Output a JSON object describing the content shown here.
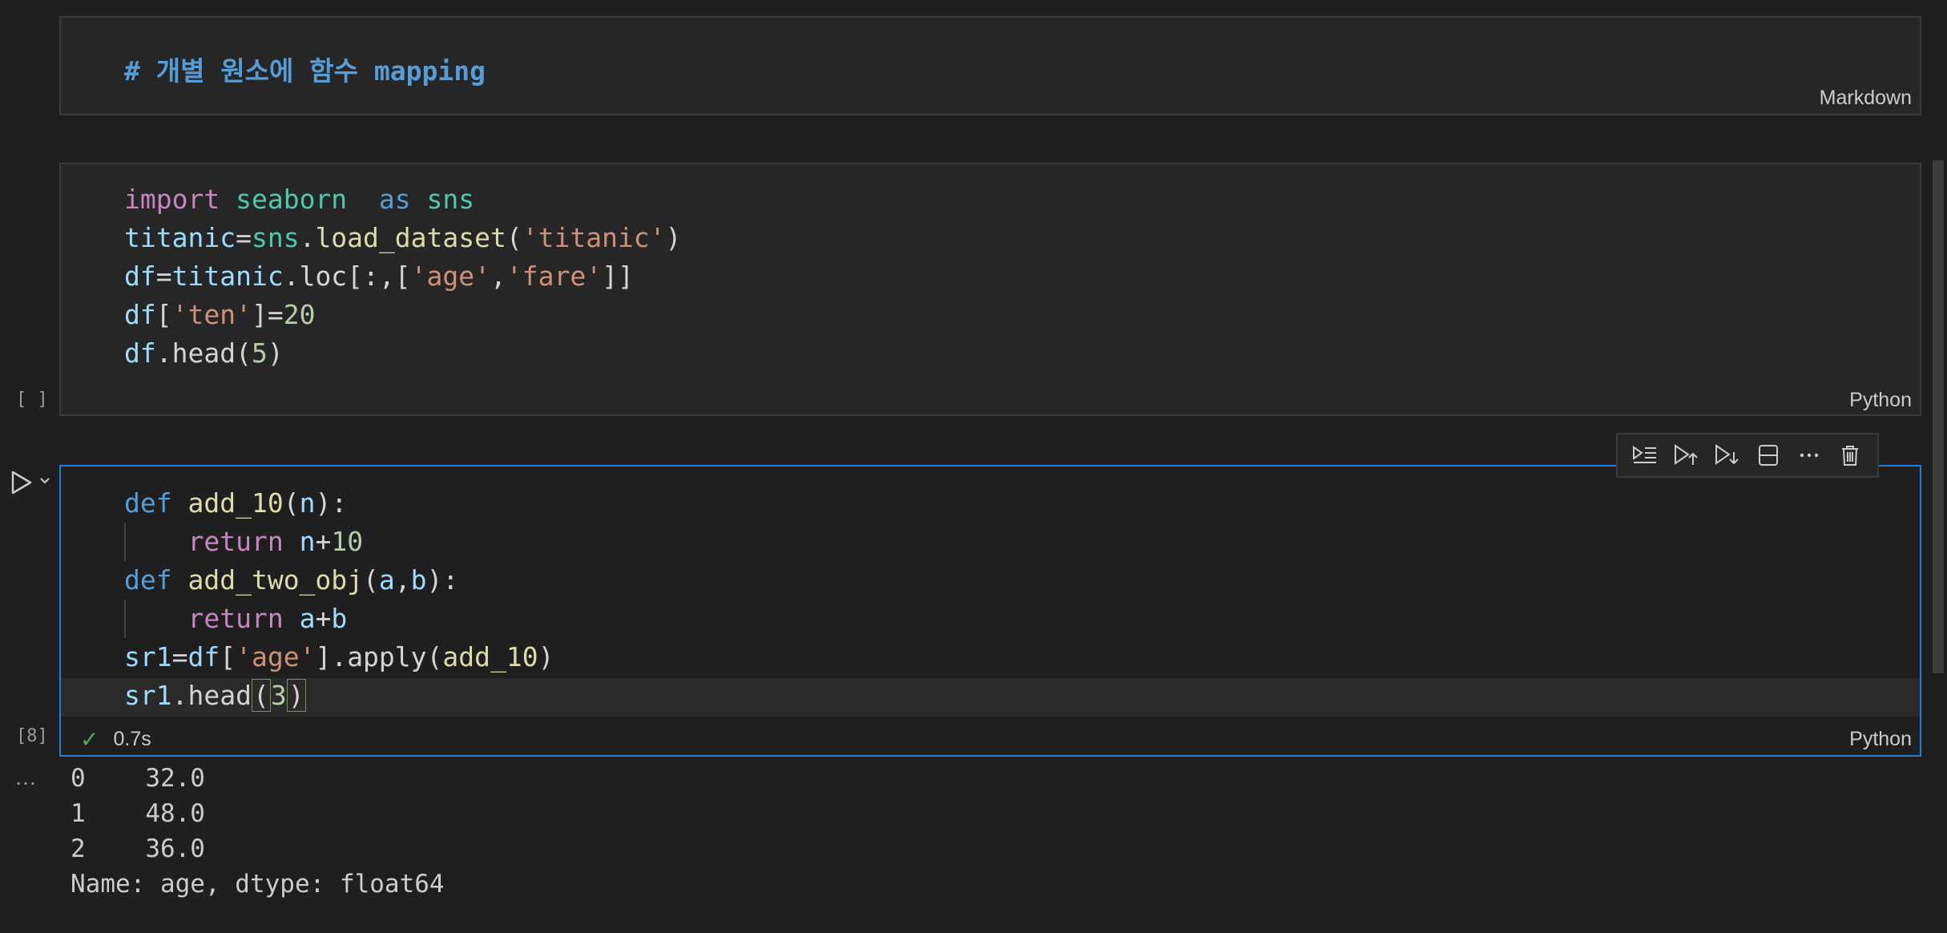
{
  "markdown_cell": {
    "heading": "# 개별 원소에 함수 mapping",
    "language": "Markdown"
  },
  "cell1": {
    "execution_count": "[ ]",
    "language": "Python",
    "lines": [
      [
        {
          "t": "import",
          "c": "kw-purple"
        },
        {
          "t": " "
        },
        {
          "t": "seaborn",
          "c": "mod"
        },
        {
          "t": "  "
        },
        {
          "t": "as",
          "c": "kw-blue"
        },
        {
          "t": " "
        },
        {
          "t": "sns",
          "c": "mod"
        }
      ],
      [
        {
          "t": "titanic",
          "c": "var"
        },
        {
          "t": "="
        },
        {
          "t": "sns",
          "c": "mod"
        },
        {
          "t": "."
        },
        {
          "t": "load_dataset",
          "c": "fn"
        },
        {
          "t": "("
        },
        {
          "t": "'titanic'",
          "c": "str"
        },
        {
          "t": ")"
        }
      ],
      [
        {
          "t": "df",
          "c": "var"
        },
        {
          "t": "="
        },
        {
          "t": "titanic",
          "c": "var"
        },
        {
          "t": ".loc[:,["
        },
        {
          "t": "'age'",
          "c": "str"
        },
        {
          "t": ","
        },
        {
          "t": "'fare'",
          "c": "str"
        },
        {
          "t": "]]"
        }
      ],
      [
        {
          "t": "df",
          "c": "var"
        },
        {
          "t": "["
        },
        {
          "t": "'ten'",
          "c": "str"
        },
        {
          "t": "]="
        },
        {
          "t": "20",
          "c": "num"
        }
      ],
      [
        {
          "t": "df",
          "c": "var"
        },
        {
          "t": ".head("
        },
        {
          "t": "5",
          "c": "num"
        },
        {
          "t": ")"
        }
      ]
    ]
  },
  "cell2": {
    "execution_count": "[8]",
    "language": "Python",
    "duration": "0.7s",
    "lines": [
      [
        {
          "t": "def",
          "c": "kw-blue"
        },
        {
          "t": " "
        },
        {
          "t": "add_10",
          "c": "fn"
        },
        {
          "t": "("
        },
        {
          "t": "n",
          "c": "var"
        },
        {
          "t": "):"
        }
      ],
      [
        {
          "t": "    "
        },
        {
          "t": "return",
          "c": "kw-purple"
        },
        {
          "t": " "
        },
        {
          "t": "n",
          "c": "var"
        },
        {
          "t": "+"
        },
        {
          "t": "10",
          "c": "num"
        }
      ],
      [
        {
          "t": "def",
          "c": "kw-blue"
        },
        {
          "t": " "
        },
        {
          "t": "add_two_obj",
          "c": "fn"
        },
        {
          "t": "("
        },
        {
          "t": "a",
          "c": "var"
        },
        {
          "t": ","
        },
        {
          "t": "b",
          "c": "var"
        },
        {
          "t": "):"
        }
      ],
      [
        {
          "t": "    "
        },
        {
          "t": "return",
          "c": "kw-purple"
        },
        {
          "t": " "
        },
        {
          "t": "a",
          "c": "var"
        },
        {
          "t": "+"
        },
        {
          "t": "b",
          "c": "var"
        }
      ],
      [
        {
          "t": "sr1",
          "c": "var"
        },
        {
          "t": "="
        },
        {
          "t": "df",
          "c": "var"
        },
        {
          "t": "["
        },
        {
          "t": "'age'",
          "c": "str"
        },
        {
          "t": "].apply("
        },
        {
          "t": "add_10",
          "c": "fn"
        },
        {
          "t": ")"
        }
      ],
      [
        {
          "t": "sr1",
          "c": "var"
        },
        {
          "t": ".head"
        },
        {
          "t": "(",
          "c": "bracket"
        },
        {
          "t": "3",
          "c": "num"
        },
        {
          "t": ")",
          "c": "bracket"
        }
      ]
    ]
  },
  "output": {
    "ellipsis": "…",
    "lines": [
      "0    32.0",
      "1    48.0",
      "2    36.0",
      "Name: age, dtype: float64"
    ]
  },
  "toolbar": {
    "icons": [
      "execute-above-icon",
      "run-above-icon",
      "run-below-icon",
      "split-cell-icon",
      "more-icon",
      "delete-icon"
    ]
  }
}
